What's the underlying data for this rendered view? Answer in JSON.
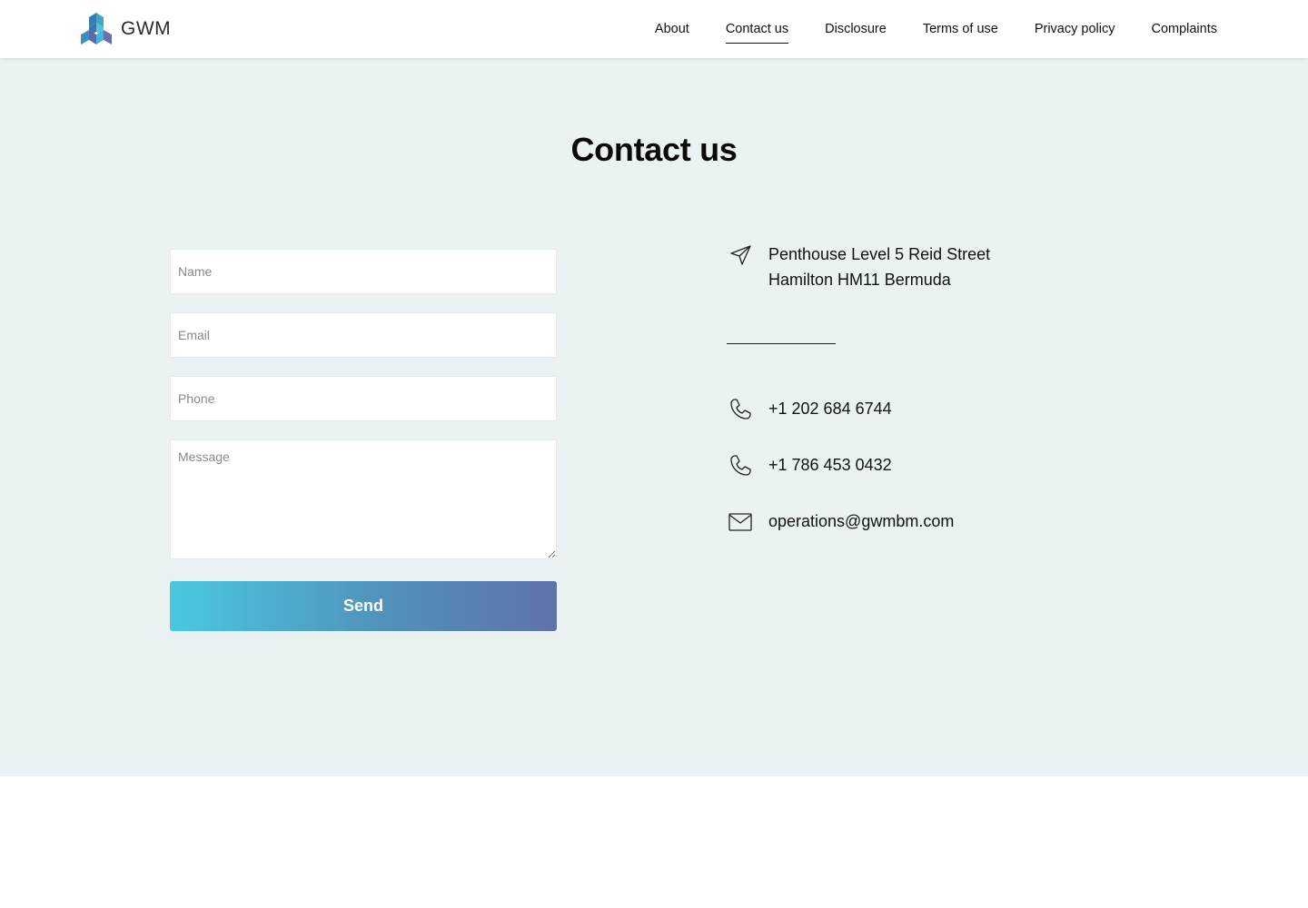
{
  "header": {
    "logo_text": "GWM",
    "nav": [
      {
        "label": "About"
      },
      {
        "label": "Contact us",
        "active": true
      },
      {
        "label": "Disclosure"
      },
      {
        "label": "Terms of use"
      },
      {
        "label": "Privacy policy"
      },
      {
        "label": "Complaints"
      }
    ]
  },
  "page": {
    "title": "Contact us"
  },
  "form": {
    "name_placeholder": "Name",
    "email_placeholder": "Email",
    "phone_placeholder": "Phone",
    "message_placeholder": "Message",
    "send_label": "Send"
  },
  "contact": {
    "address_line1": "Penthouse Level 5 Reid Street",
    "address_line2": "Hamilton HM11 Bermuda",
    "phone1": "+1 202 684 6744",
    "phone2": "+1 786 453 0432",
    "email": "operations@gwmbm.com"
  },
  "colors": {
    "page_bg": "#eaf2f3",
    "button_gradient_start": "#4ac8e0",
    "button_gradient_end": "#6072aa"
  },
  "icons": {
    "address": "send-arrow-icon",
    "phone": "phone-icon",
    "email": "envelope-icon"
  }
}
